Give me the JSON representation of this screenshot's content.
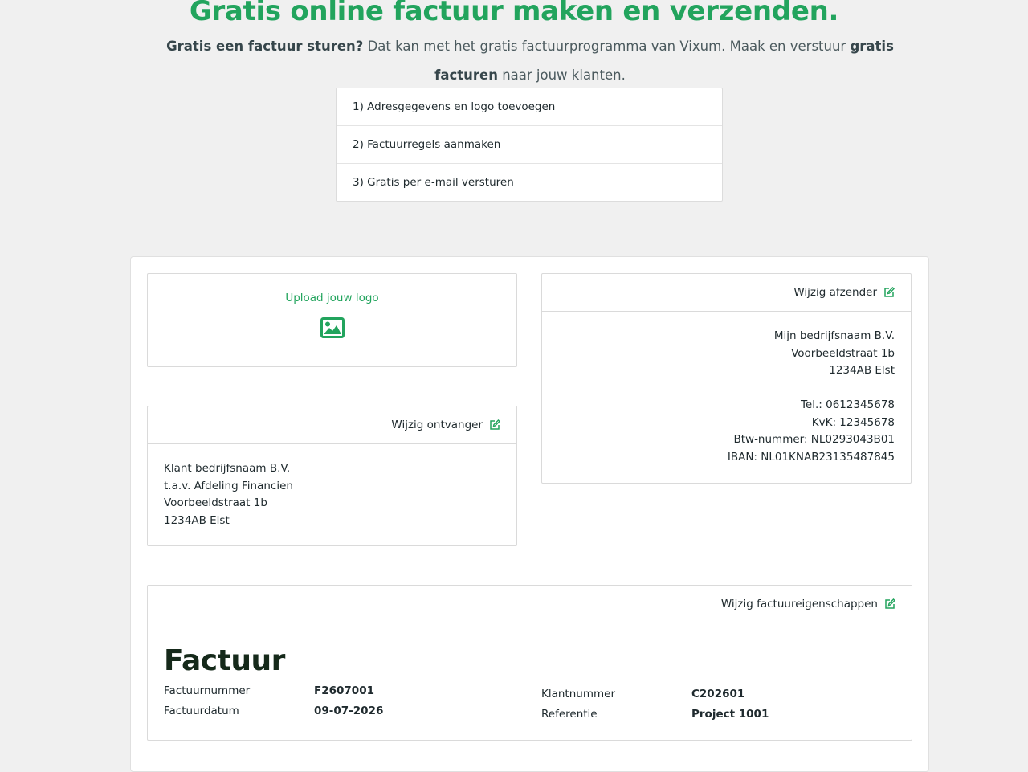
{
  "hero": {
    "title": "Gratis online factuur maken en verzenden.",
    "sub_bold_1": "Gratis een factuur sturen?",
    "sub_text_1": " Dat kan met het gratis factuurprogramma van Vixum. Maak en verstuur ",
    "sub_bold_2": "gratis facturen",
    "sub_text_2": " naar jouw klanten."
  },
  "steps": [
    "1) Adresgegevens en logo toevoegen",
    "2) Factuurregels aanmaken",
    "3) Gratis per e-mail versturen"
  ],
  "logo": {
    "upload_label": "Upload jouw logo",
    "icon": "image-icon"
  },
  "recipient": {
    "edit_label": "Wijzig ontvanger",
    "lines": [
      "Klant bedrijfsnaam B.V.",
      "t.a.v. Afdeling Financien",
      "Voorbeeldstraat 1b",
      "1234AB Elst"
    ]
  },
  "sender": {
    "edit_label": "Wijzig afzender",
    "lines": [
      "Mijn bedrijfsnaam B.V.",
      "Voorbeeldstraat 1b",
      "1234AB Elst",
      "",
      "Tel.: 0612345678",
      "KvK: 12345678",
      "Btw-nummer: NL0293043B01",
      "IBAN: NL01KNAB23135487845"
    ]
  },
  "invoice": {
    "edit_label": "Wijzig factuureigenschappen",
    "title": "Factuur",
    "invoice_number_label": "Factuurnummer",
    "invoice_number": "F2607001",
    "invoice_date_label": "Factuurdatum",
    "invoice_date": "09-07-2026",
    "customer_number_label": "Klantnummer",
    "customer_number": "C202601",
    "reference_label": "Referentie",
    "reference": "Project 1001"
  },
  "colors": {
    "accent": "#22a45d",
    "heading_dark": "#15291a",
    "background": "#f0f0f0"
  }
}
